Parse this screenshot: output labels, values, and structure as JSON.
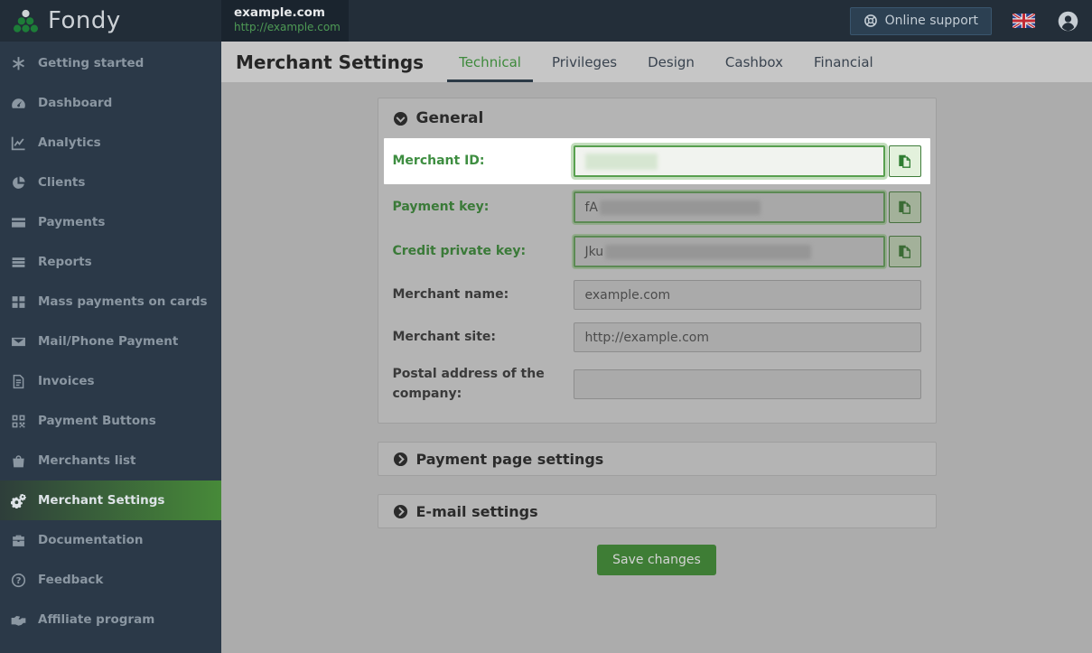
{
  "brand": {
    "name": "Fondy"
  },
  "topbar": {
    "merchant_tab": {
      "name": "example.com",
      "url": "http://example.com"
    },
    "online_support": "Online support"
  },
  "sidebar": {
    "items": [
      {
        "label": "Getting started",
        "icon": "asterisk-icon",
        "active": false
      },
      {
        "label": "Dashboard",
        "icon": "dashboard-icon",
        "active": false
      },
      {
        "label": "Analytics",
        "icon": "analytics-icon",
        "active": false
      },
      {
        "label": "Clients",
        "icon": "clients-icon",
        "active": false
      },
      {
        "label": "Payments",
        "icon": "credit-card-icon",
        "active": false
      },
      {
        "label": "Reports",
        "icon": "reports-icon",
        "active": false
      },
      {
        "label": "Mass payments on cards",
        "icon": "grid-icon",
        "active": false
      },
      {
        "label": "Mail/Phone Payment",
        "icon": "envelope-icon",
        "active": false
      },
      {
        "label": "Invoices",
        "icon": "invoice-file-icon",
        "active": false
      },
      {
        "label": "Payment Buttons",
        "icon": "qrcode-icon",
        "active": false
      },
      {
        "label": "Merchants list",
        "icon": "shopping-bag-icon",
        "active": false
      },
      {
        "label": "Merchant Settings",
        "icon": "gears-icon",
        "active": true
      },
      {
        "label": "Documentation",
        "icon": "briefcase-icon",
        "active": false
      },
      {
        "label": "Feedback",
        "icon": "question-circle-icon",
        "active": false
      },
      {
        "label": "Affiliate program",
        "icon": "handshake-icon",
        "active": false
      }
    ]
  },
  "header": {
    "title": "Merchant Settings",
    "tabs": [
      {
        "label": "Technical",
        "active": true
      },
      {
        "label": "Privileges",
        "active": false
      },
      {
        "label": "Design",
        "active": false
      },
      {
        "label": "Cashbox",
        "active": false
      },
      {
        "label": "Financial",
        "active": false
      }
    ]
  },
  "general": {
    "title": "General",
    "fields": [
      {
        "label": "Merchant ID:",
        "value": "",
        "masked": true,
        "copyable": true,
        "highlighted": true
      },
      {
        "label": "Payment key:",
        "value_prefix": "fA",
        "masked": true,
        "copyable": true
      },
      {
        "label": "Credit private key:",
        "value_prefix": "Jku",
        "masked": true,
        "copyable": true
      },
      {
        "label": "Merchant name:",
        "value": "example.com"
      },
      {
        "label": "Merchant site:",
        "value": "http://example.com"
      },
      {
        "label": "Postal address of the company:",
        "value": ""
      }
    ]
  },
  "collapsed_sections": [
    {
      "title": "Payment page settings"
    },
    {
      "title": "E-mail settings"
    }
  ],
  "actions": {
    "save": "Save changes"
  },
  "colors": {
    "accent_green": "#3e8a3c",
    "sidebar_active_green": "#478a39",
    "topbar_bg": "#232e39",
    "sidebar_bg": "#2b3948",
    "highlight_bg": "#ffffff",
    "save_button_green": "#3e7d35"
  }
}
